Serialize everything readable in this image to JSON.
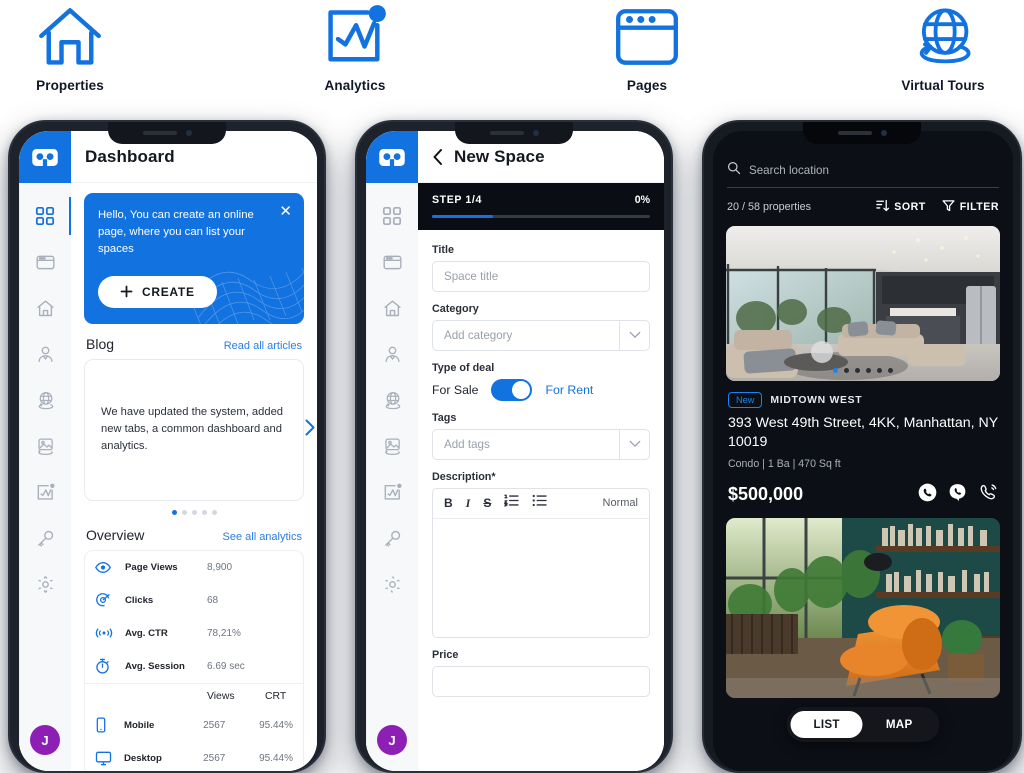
{
  "top_icons": [
    {
      "label": "Properties",
      "icon": "house-icon"
    },
    {
      "label": "Analytics",
      "icon": "analytics-chart-icon"
    },
    {
      "label": "Pages",
      "icon": "browser-window-icon"
    },
    {
      "label": "Virtual Tours",
      "icon": "globe-360-icon"
    }
  ],
  "colors": {
    "brand_blue": "#1272e0",
    "accent_blue": "#1786f0",
    "avatar_purple": "#8e1fb5",
    "dark_panel": "#0a0d13",
    "phone3_bg": "#0c0f16"
  },
  "rail": {
    "logo_icon": "vr-goggles-logo",
    "avatar_initial": "J",
    "items": [
      {
        "name": "dashboard",
        "icon": "grid-icon",
        "active": true
      },
      {
        "name": "pages",
        "icon": "browser-window-icon",
        "active": false
      },
      {
        "name": "properties",
        "icon": "house-icon",
        "active": false
      },
      {
        "name": "agents",
        "icon": "agent-person-icon",
        "active": false
      },
      {
        "name": "virtual-tours",
        "icon": "globe-360-icon",
        "active": false
      },
      {
        "name": "gallery",
        "icon": "image-rotate-icon",
        "active": false
      },
      {
        "name": "analytics",
        "icon": "analytics-chart-icon",
        "active": false
      },
      {
        "name": "access-keys",
        "icon": "key-icon",
        "active": false
      },
      {
        "name": "settings",
        "icon": "gear-icon",
        "active": false
      }
    ]
  },
  "phone1": {
    "title": "Dashboard",
    "promo": {
      "text": "Hello, You can create an online page, where you can list your spaces",
      "create_label": "CREATE",
      "close_icon": "close-icon"
    },
    "blog": {
      "heading": "Blog",
      "link": "Read all articles",
      "card_text": "We have updated the system, added new tabs, a common dashboard and analytics.",
      "dots_total": 5,
      "dots_active": 1
    },
    "overview": {
      "heading": "Overview",
      "link": "See all analytics",
      "metrics": [
        {
          "icon": "eye-icon",
          "label": "Page Views",
          "value": "8,900"
        },
        {
          "icon": "click-target-icon",
          "label": "Clicks",
          "value": "68"
        },
        {
          "icon": "signal-icon",
          "label": "Avg. CTR",
          "value": "78,21%"
        },
        {
          "icon": "stopwatch-icon",
          "label": "Avg. Session",
          "value": "6.69 sec"
        }
      ],
      "table_headers": {
        "col1": "Views",
        "col2": "CRT"
      },
      "devices": [
        {
          "icon": "mobile-icon",
          "label": "Mobile",
          "views": "2567",
          "crt": "95.44%"
        },
        {
          "icon": "desktop-icon",
          "label": "Desktop",
          "views": "2567",
          "crt": "95.44%"
        }
      ]
    }
  },
  "phone2": {
    "title": "New Space",
    "back_icon": "chevron-left-icon",
    "step": {
      "label": "STEP 1/4",
      "percent": "0%",
      "progress_ratio": 0.28
    },
    "fields": {
      "title_label": "Title",
      "title_placeholder": "Space title",
      "category_label": "Category",
      "category_placeholder": "Add category",
      "deal_label": "Type of deal",
      "deal_left": "For Sale",
      "deal_right": "For Rent",
      "deal_selected": "For Rent",
      "tags_label": "Tags",
      "tags_placeholder": "Add tags",
      "description_label": "Description*",
      "price_label": "Price"
    },
    "editor_tools": {
      "bold": "B",
      "italic": "I",
      "strike": "S",
      "ordered_list_icon": "ordered-list-icon",
      "bullet_list_icon": "bullet-list-icon",
      "style": "Normal"
    }
  },
  "phone3": {
    "search_placeholder": "Search location",
    "search_icon": "search-icon",
    "count": "20 / 58 properties",
    "sort_label": "SORT",
    "sort_icon": "sort-icon",
    "filter_label": "FILTER",
    "filter_icon": "filter-icon",
    "listing": {
      "badge": "New",
      "neighborhood": "MIDTOWN WEST",
      "address": "393 West 49th Street, 4KK, Manhattan, NY 10019",
      "specs": "Condo | 1 Ba | 470 Sq ft",
      "price": "$500,000",
      "dots_total": 6,
      "dots_active": 1,
      "contacts": [
        {
          "icon": "whatsapp-icon"
        },
        {
          "icon": "viber-icon"
        },
        {
          "icon": "phone-ring-icon"
        }
      ]
    },
    "view_toggle": {
      "list": "LIST",
      "map": "MAP",
      "selected": "LIST"
    }
  }
}
